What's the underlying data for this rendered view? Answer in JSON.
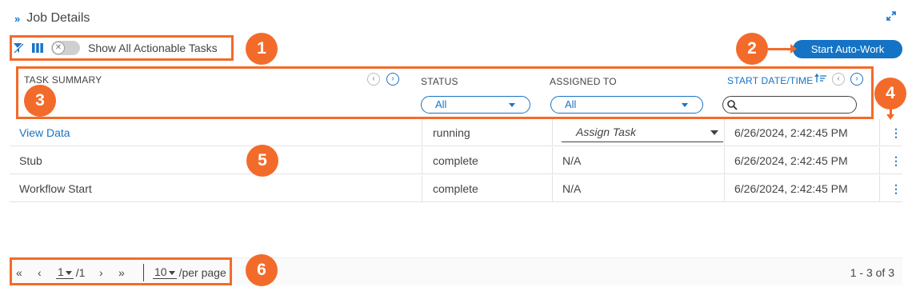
{
  "panel": {
    "title": "Job Details"
  },
  "toolbar": {
    "show_actionable_label": "Show All Actionable Tasks",
    "start_auto_work_label": "Start Auto-Work"
  },
  "columns": {
    "task_summary": "TASK SUMMARY",
    "status": "STATUS",
    "assigned_to": "ASSIGNED TO",
    "start_date": "START DATE/TIME"
  },
  "filters": {
    "status_value": "All",
    "assigned_value": "All",
    "search_placeholder": ""
  },
  "rows": [
    {
      "task": "View Data",
      "status": "running",
      "assigned": "Assign Task",
      "start": "6/26/2024, 2:42:45 PM"
    },
    {
      "task": "Stub",
      "status": "complete",
      "assigned": "N/A",
      "start": "6/26/2024, 2:42:45 PM"
    },
    {
      "task": "Workflow Start",
      "status": "complete",
      "assigned": "N/A",
      "start": "6/26/2024, 2:42:45 PM"
    }
  ],
  "pagination": {
    "page": "1",
    "total_pages": "/1",
    "per_page": "10",
    "per_page_label": "/per page",
    "range": "1 - 3 of 3"
  },
  "callouts": {
    "c1": "1",
    "c2": "2",
    "c3": "3",
    "c4": "4",
    "c5": "5",
    "c6": "6"
  },
  "colors": {
    "accent": "#1473c4",
    "callout": "#f36b2a"
  }
}
